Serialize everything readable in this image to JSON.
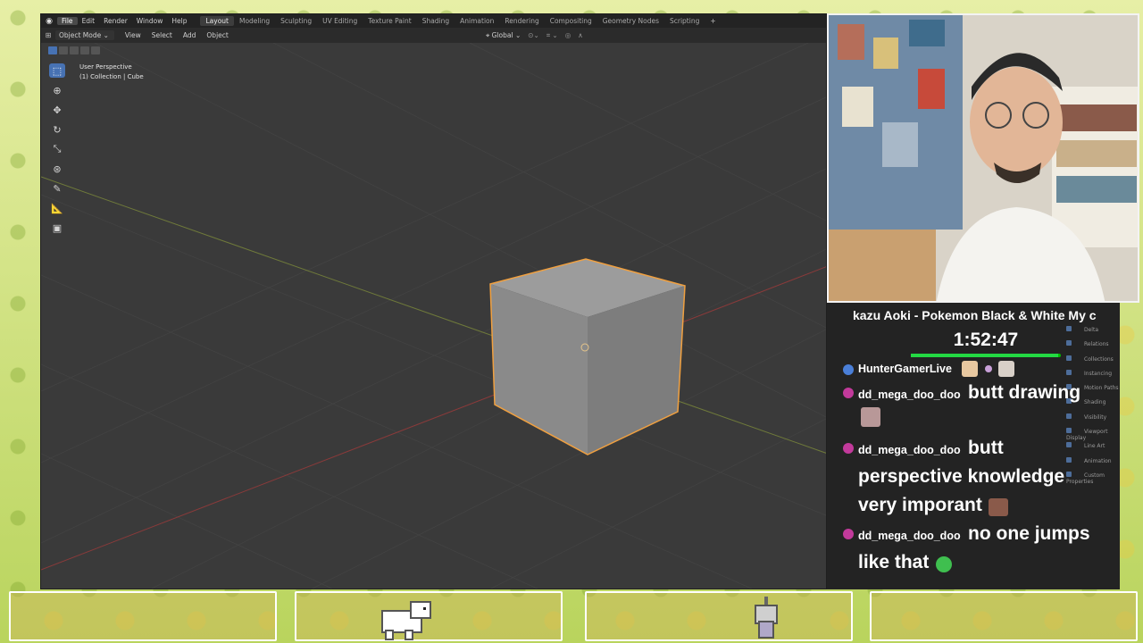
{
  "blender": {
    "menus": [
      "File",
      "Edit",
      "Render",
      "Window",
      "Help"
    ],
    "workspaces": [
      "Layout",
      "Modeling",
      "Sculpting",
      "UV Editing",
      "Texture Paint",
      "Shading",
      "Animation",
      "Rendering",
      "Compositing",
      "Geometry Nodes",
      "Scripting"
    ],
    "active_workspace": "Layout",
    "header": {
      "mode": "Object Mode",
      "view": "View",
      "select": "Select",
      "add": "Add",
      "object": "Object",
      "orientation": "Global"
    },
    "viewport": {
      "perspective_label": "User Perspective",
      "collection_label": "(1) Collection | Cube"
    },
    "tools": [
      "select-box-icon",
      "cursor-icon",
      "move-icon",
      "rotate-icon",
      "scale-icon",
      "transform-icon",
      "annotate-icon",
      "measure-icon",
      "add-cube-icon"
    ]
  },
  "stream": {
    "title": "kazu Aoki - Pokemon Black & White My c",
    "timer": "1:52:47",
    "timer_progress": 0.98,
    "side_props": [
      "Delta",
      "Relations",
      "Collections",
      "Instancing",
      "Motion Paths",
      "Shading",
      "Visibility",
      "Viewport Display",
      "Line Art",
      "Animation",
      "Custom Properties"
    ]
  },
  "chat": [
    {
      "user": "HunterGamerLive",
      "text": "",
      "dot_color": "#4a7fd8"
    },
    {
      "user": "dd_mega_doo_doo",
      "text": "butt drawing",
      "dot_color": "#c23a9b"
    },
    {
      "user": "dd_mega_doo_doo",
      "text": "butt perspective knowledge very imporant",
      "dot_color": "#c23a9b"
    },
    {
      "user": "dd_mega_doo_doo",
      "text": "no one jumps like that",
      "dot_color": "#c23a9b"
    }
  ],
  "colors": {
    "blender_bg": "#3a3a3a",
    "selection_outline": "#f0a040",
    "accent_blue": "#4772b3",
    "timer_green": "#23d943"
  }
}
